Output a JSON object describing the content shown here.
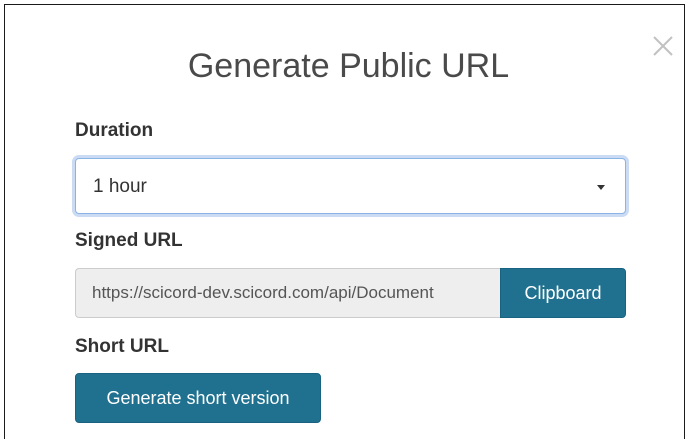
{
  "dialog": {
    "title": "Generate Public URL",
    "close_icon": "close-icon"
  },
  "duration": {
    "label": "Duration",
    "selected": "1 hour"
  },
  "signed_url": {
    "label": "Signed URL",
    "value": "https://scicord-dev.scicord.com/api/Document",
    "copy_label": "Clipboard"
  },
  "short_url": {
    "label": "Short URL",
    "button_label": "Generate short version"
  },
  "colors": {
    "primary_button": "#20718f",
    "focus_ring": "#8ab4e6",
    "readonly_bg": "#eeeeee",
    "title_text": "#4a4a4a"
  }
}
